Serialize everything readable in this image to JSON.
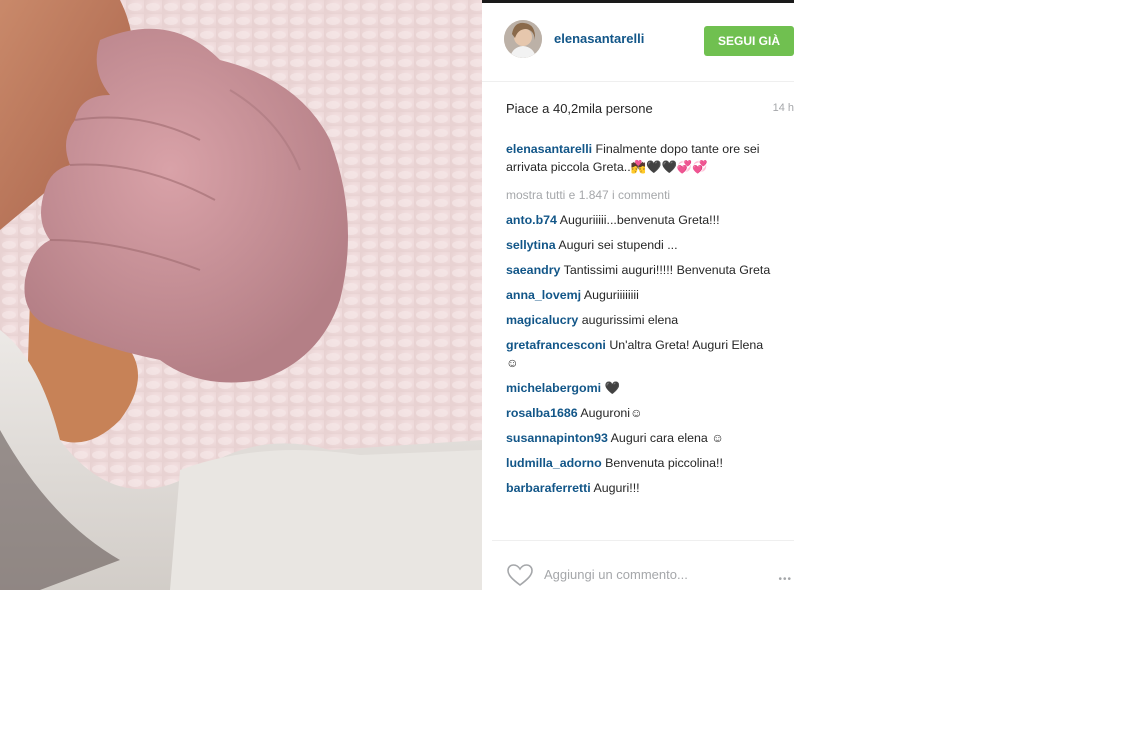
{
  "post": {
    "username": "elenasantarelli",
    "follow_label": "SEGUI GIÀ",
    "likes": "Piace a 40,2mila persone",
    "time_ago": "14 h",
    "caption_user": "elenasantarelli",
    "caption_text": "Finalmente dopo tante ore sei arrivata piccola Greta..💏🖤🖤💞💞",
    "view_all_comments": "mostra tutti e 1.847 i commenti",
    "add_comment_placeholder": "Aggiungi un commento...",
    "more_icon": "•••"
  },
  "comments": [
    {
      "user": "anto.b74",
      "text": "Auguriiiii...benvenuta Greta!!!"
    },
    {
      "user": "sellytina",
      "text": "Auguri sei stupendi ..."
    },
    {
      "user": "saeandry",
      "text": "Tantissimi auguri!!!!! Benvenuta Greta"
    },
    {
      "user": "anna_lovemj",
      "text": "Auguriiiiiiii"
    },
    {
      "user": "magicalucry",
      "text": "augurissimi elena"
    },
    {
      "user": "gretafrancesconi",
      "text": "Un'altra Greta! Auguri Elena ☺"
    },
    {
      "user": "michelabergomi",
      "text": "🖤"
    },
    {
      "user": "rosalba1686",
      "text": "Auguroni☺"
    },
    {
      "user": "susannapinton93",
      "text": "Auguri cara elena ☺"
    },
    {
      "user": "ludmilla_adorno",
      "text": "Benvenuta piccolina!!"
    },
    {
      "user": "barbaraferretti",
      "text": "Auguri!!!"
    }
  ],
  "icons": {
    "heart": "heart-icon",
    "avatar": "avatar",
    "more": "more-options-icon"
  },
  "colors": {
    "link": "#125688",
    "follow_button": "#70c050",
    "muted": "#a5a7aa"
  }
}
